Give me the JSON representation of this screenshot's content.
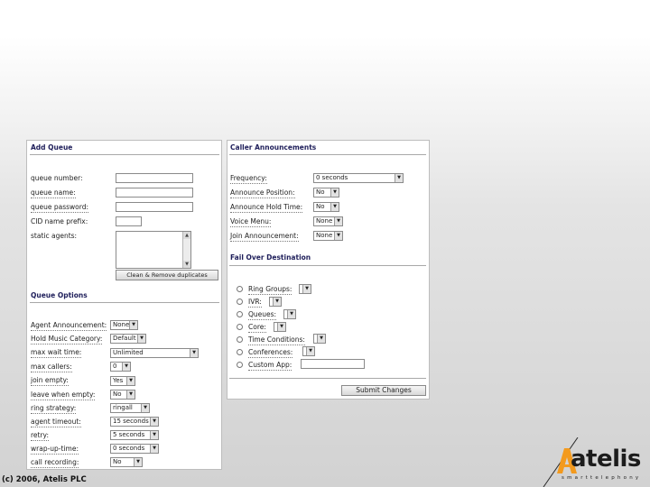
{
  "add_queue": {
    "title": "Add Queue",
    "queue_number_label": "queue number:",
    "queue_number_value": "",
    "queue_name_label": "queue name:",
    "queue_name_value": "",
    "queue_password_label": "queue password:",
    "queue_password_value": "",
    "cid_prefix_label": "CID name prefix:",
    "cid_prefix_value": "",
    "static_agents_label": "static agents:",
    "static_agents_value": "",
    "clean_button": "Clean & Remove duplicates"
  },
  "queue_options": {
    "title": "Queue Options",
    "fields": [
      {
        "label": "Agent Announcement:",
        "value": "None"
      },
      {
        "label": "Hold Music Category:",
        "value": "Default"
      },
      {
        "label": "max wait time:",
        "value": "Unlimited"
      },
      {
        "label": "max callers:",
        "value": "0"
      },
      {
        "label": "join empty:",
        "value": "Yes"
      },
      {
        "label": "leave when empty:",
        "value": "No"
      },
      {
        "label": "ring strategy:",
        "value": "ringall"
      },
      {
        "label": "agent timeout:",
        "value": "15 seconds"
      },
      {
        "label": "retry:",
        "value": "5 seconds"
      },
      {
        "label": "wrap-up-time:",
        "value": "0 seconds"
      },
      {
        "label": "call recording:",
        "value": "No"
      }
    ]
  },
  "caller_announcements": {
    "title": "Caller Announcements",
    "fields": [
      {
        "label": "Frequency:",
        "value": "0 seconds"
      },
      {
        "label": "Announce Position:",
        "value": "No"
      },
      {
        "label": "Announce Hold Time:",
        "value": "No"
      },
      {
        "label": "Voice Menu:",
        "value": "None"
      },
      {
        "label": "Join Announcement:",
        "value": "None"
      }
    ]
  },
  "fail_over": {
    "title": "Fail Over Destination",
    "options": [
      {
        "label": "Ring Groups:",
        "value": ""
      },
      {
        "label": "IVR:",
        "value": ""
      },
      {
        "label": "Queues:",
        "value": ""
      },
      {
        "label": "Core:",
        "value": ""
      },
      {
        "label": "Time Conditions:",
        "value": ""
      },
      {
        "label": "Conferences:",
        "value": ""
      },
      {
        "label": "Custom App:",
        "value": ""
      }
    ]
  },
  "submit_button": "Submit Changes",
  "footer": {
    "copyright": "(c) 2006, Atelis PLC"
  },
  "logo": {
    "word": "atelis",
    "tagline": "smarttelephony",
    "colors": {
      "accent": "#f39a1e",
      "dark": "#1c1c1c"
    }
  }
}
